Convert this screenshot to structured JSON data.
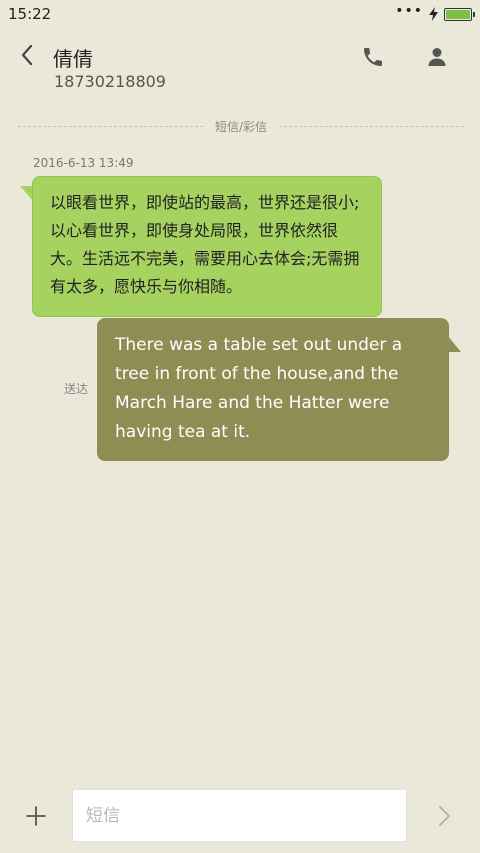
{
  "status_bar": {
    "time": "15:22",
    "battery_level": 1.0,
    "battery_color": "#7cc242"
  },
  "header": {
    "contact_name": "倩倩",
    "phone_number": "18730218809"
  },
  "conversation": {
    "divider_label": "短信/彩信",
    "timestamp": "2016-6-13 13:49",
    "messages": [
      {
        "direction": "incoming",
        "text": "以眼看世界，即使站的最高，世界还是很小;以心看世界，即使身处局限，世界依然很大。生活远不完美，需要用心去体会;无需拥有太多，愿快乐与你相随。",
        "bubble_color": "#a6d360"
      },
      {
        "direction": "outgoing",
        "text": "There was a table set out under a tree in front of the house,and the March Hare and the Hatter were having tea at it.",
        "status": "送达",
        "bubble_color": "#908d54"
      }
    ]
  },
  "composer": {
    "placeholder": "短信",
    "value": ""
  },
  "icons": {
    "back": "chevron-left-icon",
    "call": "phone-icon",
    "contact": "person-icon",
    "add": "plus-icon",
    "send": "chevron-right-icon"
  },
  "colors": {
    "background": "#eae8d8",
    "incoming_bubble": "#a6d360",
    "outgoing_bubble": "#908d54"
  }
}
